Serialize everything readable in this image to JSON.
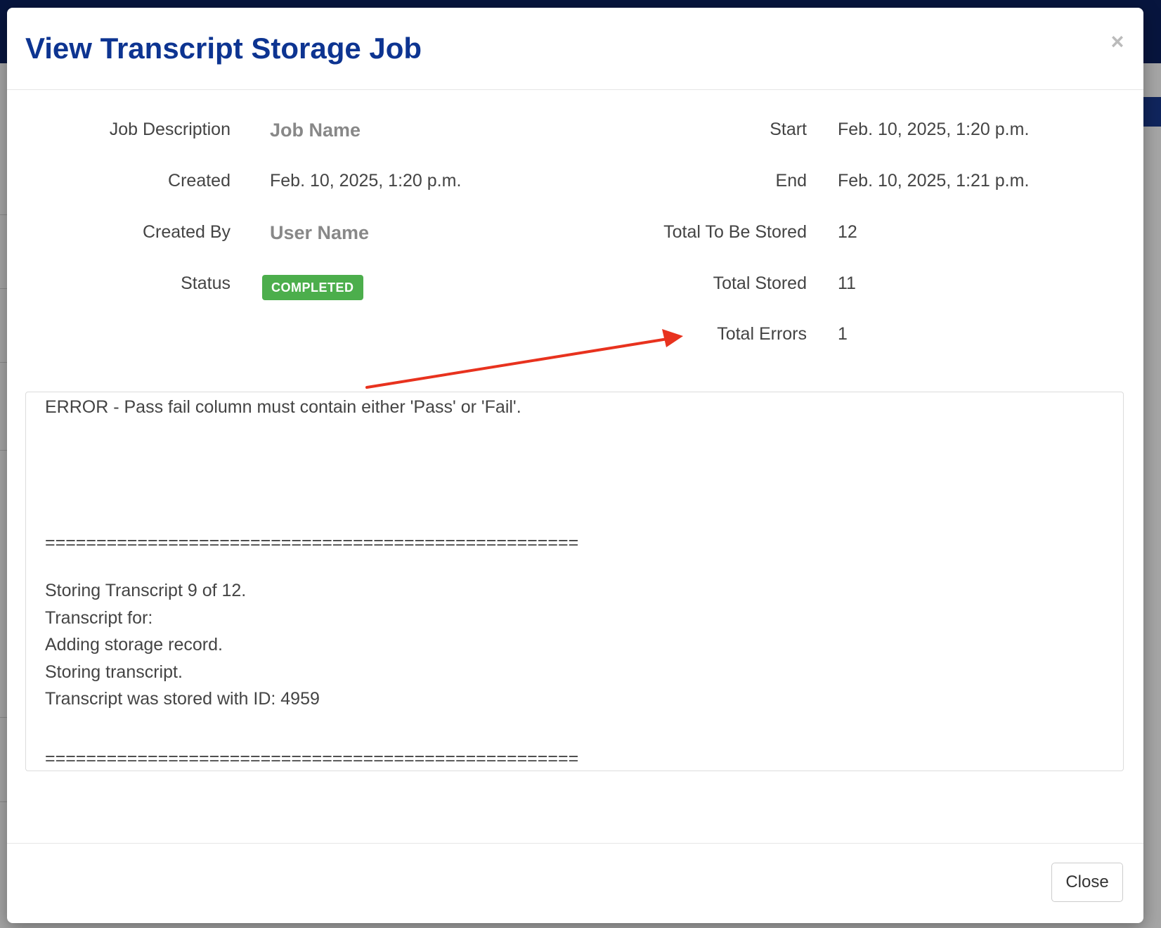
{
  "modal": {
    "title": "View Transcript Storage Job",
    "close_symbol": "×"
  },
  "details": {
    "job_description": {
      "label": "Job Description",
      "value": "Job Name"
    },
    "created": {
      "label": "Created",
      "value": "Feb. 10, 2025, 1:20 p.m."
    },
    "created_by": {
      "label": "Created By",
      "value": "User Name"
    },
    "status": {
      "label": "Status",
      "value": "COMPLETED"
    },
    "start": {
      "label": "Start",
      "value": "Feb. 10, 2025, 1:20 p.m."
    },
    "end": {
      "label": "End",
      "value": "Feb. 10, 2025, 1:21 p.m."
    },
    "total_to_be_stored": {
      "label": "Total To Be Stored",
      "value": "12"
    },
    "total_stored": {
      "label": "Total Stored",
      "value": "11"
    },
    "total_errors": {
      "label": "Total Errors",
      "value": "1"
    }
  },
  "log": {
    "lines": [
      "ERROR - Pass fail column must contain either 'Pass' or 'Fail'.",
      "====================================================",
      "Storing Transcript 9 of 12.",
      "Transcript for:",
      "Adding storage record.",
      "Storing transcript.",
      "Transcript was stored with ID: 4959",
      "===================================================="
    ]
  },
  "footer": {
    "close_label": "Close"
  },
  "colors": {
    "title": "#0d3491",
    "status_badge": "#4cae4c",
    "annotation_arrow": "#e8321e"
  }
}
